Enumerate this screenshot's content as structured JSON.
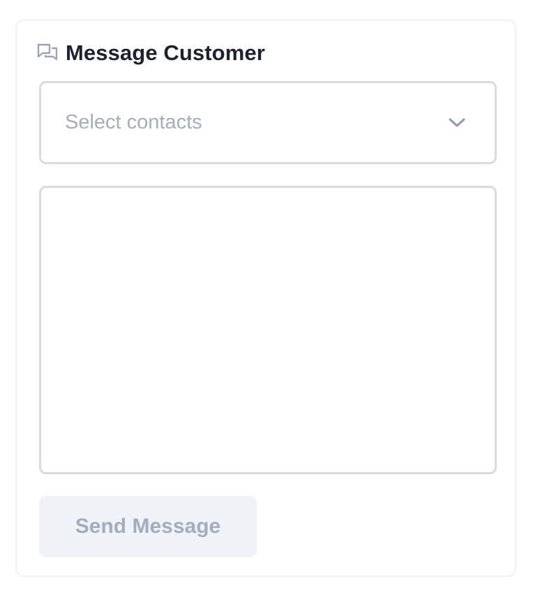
{
  "card": {
    "title": "Message Customer",
    "title_icon": "chat-bubbles-icon"
  },
  "contacts_select": {
    "placeholder": "Select contacts",
    "icon": "chevron-down-icon"
  },
  "message_textarea": {
    "value": ""
  },
  "send_button": {
    "label": "Send Message",
    "disabled": true
  },
  "colors": {
    "title_text": "#1c2233",
    "icon": "#9aa4b8",
    "placeholder": "#a3adbf",
    "border": "#d7dbe3",
    "button_bg": "#eff2f7"
  }
}
